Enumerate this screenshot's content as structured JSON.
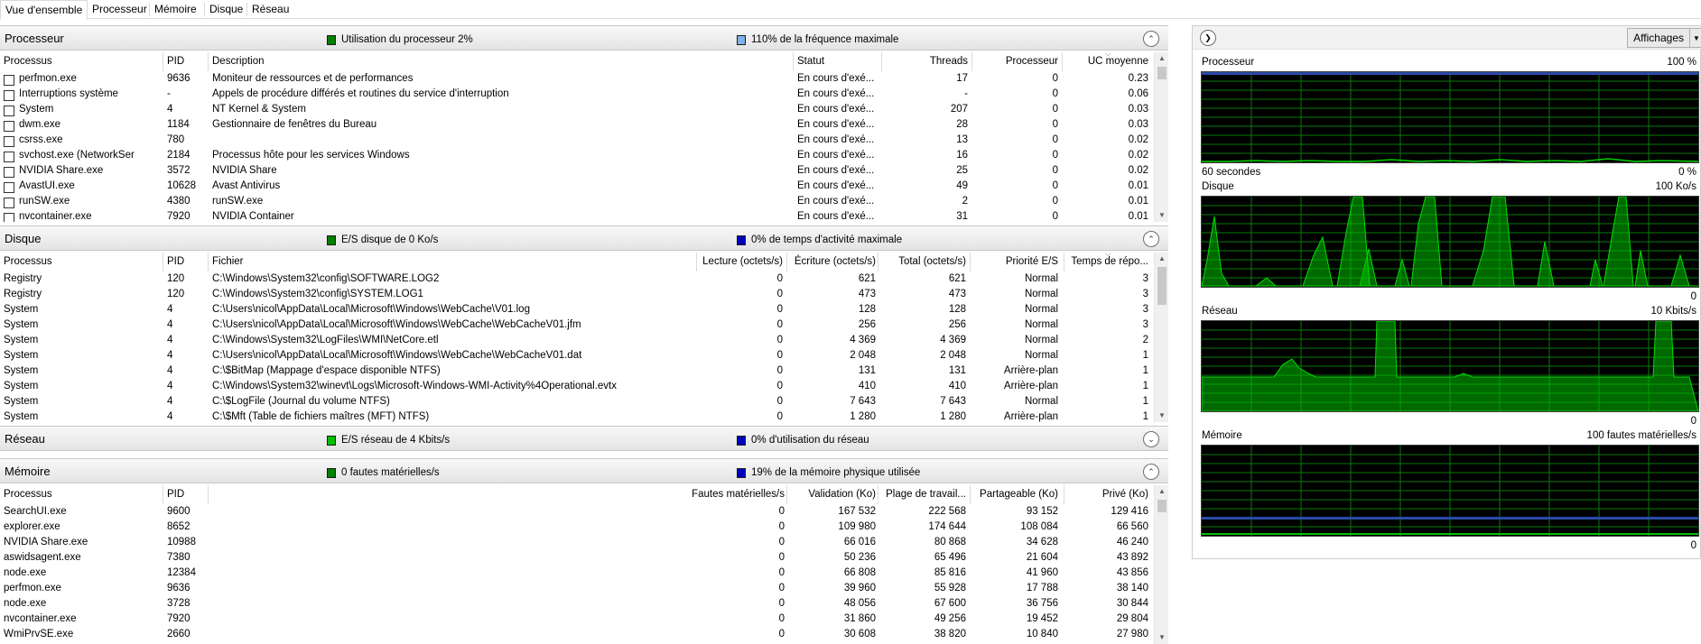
{
  "tabs": [
    {
      "label": "Vue d'ensemble",
      "active": true
    },
    {
      "label": "Processeur",
      "active": false
    },
    {
      "label": "Mémoire",
      "active": false
    },
    {
      "label": "Disque",
      "active": false
    },
    {
      "label": "Réseau",
      "active": false
    }
  ],
  "cpu": {
    "title": "Processeur",
    "ind1": "Utilisation du processeur 2%",
    "ind2": "110% de la fréquence maximale",
    "colors": {
      "ind1": "#008000",
      "ind2": "#7fb2e5"
    },
    "headers": [
      "Processus",
      "PID",
      "Description",
      "Statut",
      "Threads",
      "Processeur",
      "UC moyenne"
    ],
    "rows": [
      [
        "perfmon.exe",
        "9636",
        "Moniteur de ressources et de performances",
        "En cours d'exé...",
        "17",
        "0",
        "0.23"
      ],
      [
        "Interruptions système",
        "-",
        "Appels de procédure différés et routines du service d'interruption",
        "En cours d'exé...",
        "-",
        "0",
        "0.06"
      ],
      [
        "System",
        "4",
        "NT Kernel & System",
        "En cours d'exé...",
        "207",
        "0",
        "0.03"
      ],
      [
        "dwm.exe",
        "1184",
        "Gestionnaire de fenêtres du Bureau",
        "En cours d'exé...",
        "28",
        "0",
        "0.03"
      ],
      [
        "csrss.exe",
        "780",
        "",
        "En cours d'exé...",
        "13",
        "0",
        "0.02"
      ],
      [
        "svchost.exe (NetworkService...",
        "2184",
        "Processus hôte pour les services Windows",
        "En cours d'exé...",
        "16",
        "0",
        "0.02"
      ],
      [
        "NVIDIA Share.exe",
        "3572",
        "NVIDIA Share",
        "En cours d'exé...",
        "25",
        "0",
        "0.02"
      ],
      [
        "AvastUI.exe",
        "10628",
        "Avast Antivirus",
        "En cours d'exé...",
        "49",
        "0",
        "0.01"
      ],
      [
        "runSW.exe",
        "4380",
        "runSW.exe",
        "En cours d'exé...",
        "2",
        "0",
        "0.01"
      ],
      [
        "nvcontainer.exe",
        "7920",
        "NVIDIA Container",
        "En cours d'exé...",
        "31",
        "0",
        "0.01"
      ]
    ]
  },
  "disk": {
    "title": "Disque",
    "ind1": "E/S disque de 0 Ko/s",
    "ind2": "0% de temps d'activité maximale",
    "colors": {
      "ind1": "#008000",
      "ind2": "#0000c0"
    },
    "headers": [
      "Processus",
      "PID",
      "Fichier",
      "Lecture (octets/s)",
      "Écriture (octets/s)",
      "Total (octets/s)",
      "Priorité E/S",
      "Temps de répo..."
    ],
    "rows": [
      [
        "Registry",
        "120",
        "C:\\Windows\\System32\\config\\SOFTWARE.LOG2",
        "0",
        "621",
        "621",
        "Normal",
        "3"
      ],
      [
        "Registry",
        "120",
        "C:\\Windows\\System32\\config\\SYSTEM.LOG1",
        "0",
        "473",
        "473",
        "Normal",
        "3"
      ],
      [
        "System",
        "4",
        "C:\\Users\\nicol\\AppData\\Local\\Microsoft\\Windows\\WebCache\\V01.log",
        "0",
        "128",
        "128",
        "Normal",
        "3"
      ],
      [
        "System",
        "4",
        "C:\\Users\\nicol\\AppData\\Local\\Microsoft\\Windows\\WebCache\\WebCacheV01.jfm",
        "0",
        "256",
        "256",
        "Normal",
        "3"
      ],
      [
        "System",
        "4",
        "C:\\Windows\\System32\\LogFiles\\WMI\\NetCore.etl",
        "0",
        "4 369",
        "4 369",
        "Normal",
        "2"
      ],
      [
        "System",
        "4",
        "C:\\Users\\nicol\\AppData\\Local\\Microsoft\\Windows\\WebCache\\WebCacheV01.dat",
        "0",
        "2 048",
        "2 048",
        "Normal",
        "1"
      ],
      [
        "System",
        "4",
        "C:\\$BitMap (Mappage d'espace disponible NTFS)",
        "0",
        "131",
        "131",
        "Arrière-plan",
        "1"
      ],
      [
        "System",
        "4",
        "C:\\Windows\\System32\\winevt\\Logs\\Microsoft-Windows-WMI-Activity%4Operational.evtx",
        "0",
        "410",
        "410",
        "Arrière-plan",
        "1"
      ],
      [
        "System",
        "4",
        "C:\\$LogFile (Journal du volume NTFS)",
        "0",
        "7 643",
        "7 643",
        "Normal",
        "1"
      ],
      [
        "System",
        "4",
        "C:\\$Mft (Table de fichiers maîtres (MFT) NTFS)",
        "0",
        "1 280",
        "1 280",
        "Arrière-plan",
        "1"
      ]
    ]
  },
  "network": {
    "title": "Réseau",
    "ind1": "E/S réseau de 4 Kbits/s",
    "ind2": "0% d'utilisation du réseau",
    "colors": {
      "ind1": "#00c000",
      "ind2": "#0000c0"
    }
  },
  "memory": {
    "title": "Mémoire",
    "ind1": "0 fautes matérielles/s",
    "ind2": "19% de la mémoire physique utilisée",
    "colors": {
      "ind1": "#008000",
      "ind2": "#0000c0"
    },
    "headers": [
      "Processus",
      "PID",
      "Fautes matérielles/s",
      "Validation (Ko)",
      "Plage de travail...",
      "Partageable (Ko)",
      "Privé (Ko)"
    ],
    "rows": [
      [
        "SearchUI.exe",
        "9600",
        "0",
        "167 532",
        "222 568",
        "93 152",
        "129 416"
      ],
      [
        "explorer.exe",
        "8652",
        "0",
        "109 980",
        "174 644",
        "108 084",
        "66 560"
      ],
      [
        "NVIDIA Share.exe",
        "10988",
        "0",
        "66 016",
        "80 868",
        "34 628",
        "46 240"
      ],
      [
        "aswidsagent.exe",
        "7380",
        "0",
        "50 236",
        "65 496",
        "21 604",
        "43 892"
      ],
      [
        "node.exe",
        "12384",
        "0",
        "66 808",
        "85 816",
        "41 960",
        "43 856"
      ],
      [
        "perfmon.exe",
        "9636",
        "0",
        "39 960",
        "55 928",
        "17 788",
        "38 140"
      ],
      [
        "node.exe",
        "3728",
        "0",
        "48 056",
        "67 600",
        "36 756",
        "30 844"
      ],
      [
        "nvcontainer.exe",
        "7920",
        "0",
        "31 860",
        "49 256",
        "19 452",
        "29 804"
      ],
      [
        "WmiPrvSE.exe",
        "2660",
        "0",
        "30 608",
        "38 820",
        "10 840",
        "27 980"
      ]
    ]
  },
  "right": {
    "views_label": "Affichages",
    "graphs": [
      {
        "title": "Processeur",
        "max": "100 %",
        "bottom_left": "60 secondes",
        "bottom_right": "0 %"
      },
      {
        "title": "Disque",
        "max": "100 Ko/s",
        "bottom_left": "",
        "bottom_right": "0"
      },
      {
        "title": "Réseau",
        "max": "10 Kbits/s",
        "bottom_left": "",
        "bottom_right": "0"
      },
      {
        "title": "Mémoire",
        "max": "100 fautes matérielles/s",
        "bottom_left": "",
        "bottom_right": "0"
      }
    ],
    "icons": {
      "expand": "chevron-right-icon",
      "views_dropdown": "dropdown-arrow-icon"
    }
  }
}
